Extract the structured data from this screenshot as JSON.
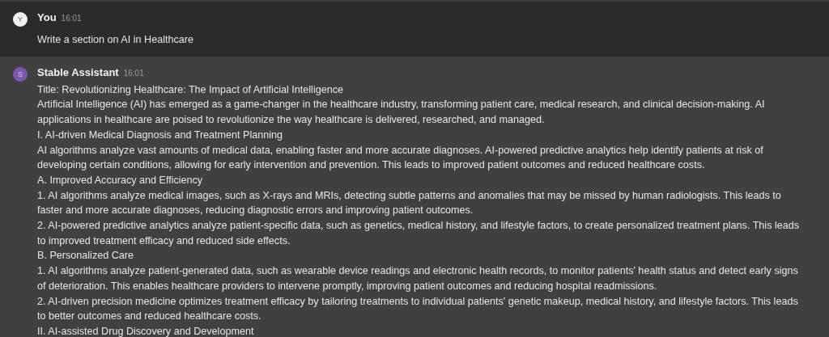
{
  "messages": [
    {
      "kind": "user",
      "avatar": "Y",
      "author": "You",
      "time": "16:01",
      "paragraphs": [
        "Write a section on AI in Healthcare"
      ]
    },
    {
      "kind": "assistant",
      "avatar": "S",
      "author": "Stable Assistant",
      "time": "16:01",
      "paragraphs": [
        "Title: Revolutionizing Healthcare: The Impact of Artificial Intelligence",
        "Artificial Intelligence (AI) has emerged as a game-changer in the healthcare industry, transforming patient care, medical research, and clinical decision-making. AI applications in healthcare are poised to revolutionize the way healthcare is delivered, researched, and managed.",
        "I. AI-driven Medical Diagnosis and Treatment Planning",
        "AI algorithms analyze vast amounts of medical data, enabling faster and more accurate diagnoses. AI-powered predictive analytics help identify patients at risk of developing certain conditions, allowing for early intervention and prevention. This leads to improved patient outcomes and reduced healthcare costs.",
        "A. Improved Accuracy and Efficiency",
        "1. AI algorithms analyze medical images, such as X-rays and MRIs, detecting subtle patterns and anomalies that may be missed by human radiologists. This leads to faster and more accurate diagnoses, reducing diagnostic errors and improving patient outcomes.",
        "2. AI-powered predictive analytics analyze patient-specific data, such as genetics, medical history, and lifestyle factors, to create personalized treatment plans. This leads to improved treatment efficacy and reduced side effects.",
        "B. Personalized Care",
        "1. AI algorithms analyze patient-generated data, such as wearable device readings and electronic health records, to monitor patients' health status and detect early signs of deterioration. This enables healthcare providers to intervene promptly, improving patient outcomes and reducing hospital readmissions.",
        "2. AI-driven precision medicine optimizes treatment efficacy by tailoring treatments to individual patients' genetic makeup, medical history, and lifestyle factors. This leads to better outcomes and reduced healthcare costs.",
        "II. AI-assisted Drug Discovery and Development"
      ]
    }
  ]
}
